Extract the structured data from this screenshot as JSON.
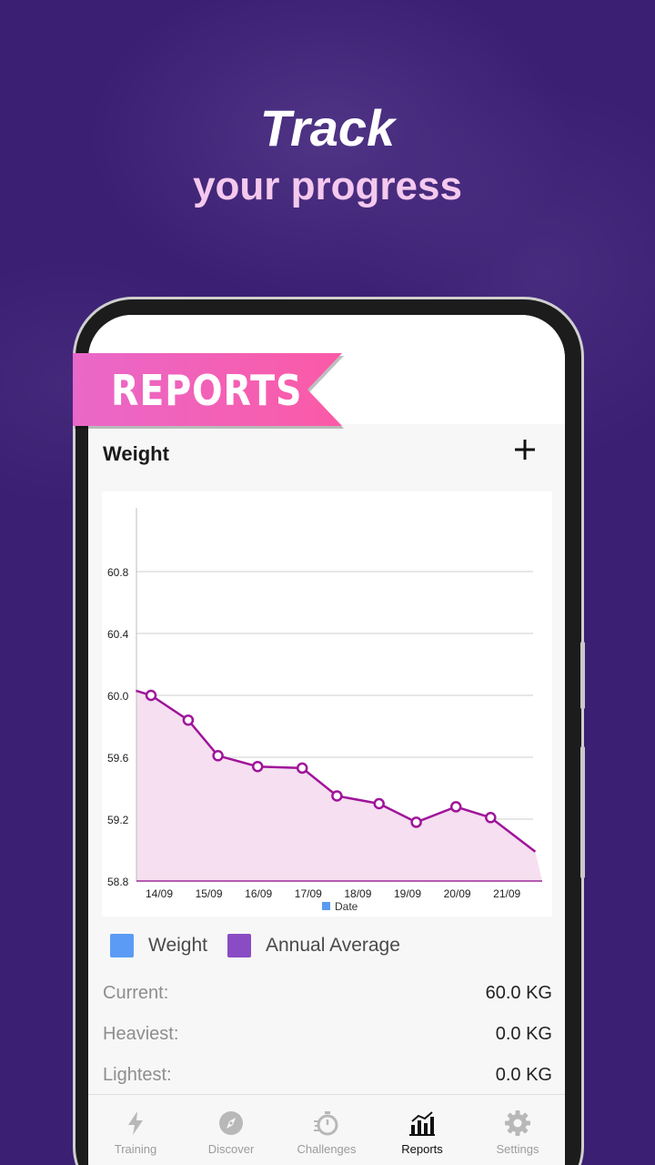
{
  "promo": {
    "headline_line1": "Track",
    "headline_line2": "your progress",
    "ribbon_label": "REPORTS",
    "ribbon_color": "#f25fb8",
    "background_color": "#3a1f72"
  },
  "header": {
    "title": "Weight",
    "add_icon": "plus-icon"
  },
  "chart_data": {
    "type": "line",
    "x": [
      "14/09",
      "15/09",
      "16/09",
      "17/09",
      "18/09",
      "19/09",
      "20/09",
      "21/09"
    ],
    "xlabel": "Date",
    "ylim": [
      58.8,
      61.0
    ],
    "yticks": [
      58.8,
      59.2,
      59.6,
      60.0,
      60.4,
      60.8
    ],
    "series": [
      {
        "name": "",
        "color": "#a0149a",
        "fill": "#f5dff0",
        "points": [
          {
            "x": 13.7,
            "y": 60.03
          },
          {
            "x": 14.0,
            "y": 60.0
          },
          {
            "x": 14.75,
            "y": 59.84
          },
          {
            "x": 15.35,
            "y": 59.61
          },
          {
            "x": 16.15,
            "y": 59.54
          },
          {
            "x": 17.05,
            "y": 59.53
          },
          {
            "x": 17.75,
            "y": 59.35
          },
          {
            "x": 18.6,
            "y": 59.3
          },
          {
            "x": 19.35,
            "y": 59.18
          },
          {
            "x": 20.15,
            "y": 59.28
          },
          {
            "x": 20.85,
            "y": 59.21
          },
          {
            "x": 21.75,
            "y": 58.99
          }
        ],
        "marked_indices": [
          1,
          2,
          3,
          4,
          5,
          6,
          7,
          8,
          9,
          10
        ]
      }
    ],
    "grid": true,
    "legend_date_color": "#5b9bf5"
  },
  "legend": [
    {
      "label": "Weight",
      "color": "#5b9bf5"
    },
    {
      "label": "Annual Average",
      "color": "#8a4cc4"
    }
  ],
  "stats": [
    {
      "label": "Current:",
      "value": "60.0 KG"
    },
    {
      "label": "Heaviest:",
      "value": "0.0 KG"
    },
    {
      "label": "Lightest:",
      "value": "0.0 KG"
    }
  ],
  "nav": [
    {
      "label": "Training",
      "icon": "lightning-icon",
      "active": false
    },
    {
      "label": "Discover",
      "icon": "compass-icon",
      "active": false
    },
    {
      "label": "Challenges",
      "icon": "stopwatch-icon",
      "active": false
    },
    {
      "label": "Reports",
      "icon": "bar-chart-icon",
      "active": true
    },
    {
      "label": "Settings",
      "icon": "gear-icon",
      "active": false
    }
  ]
}
